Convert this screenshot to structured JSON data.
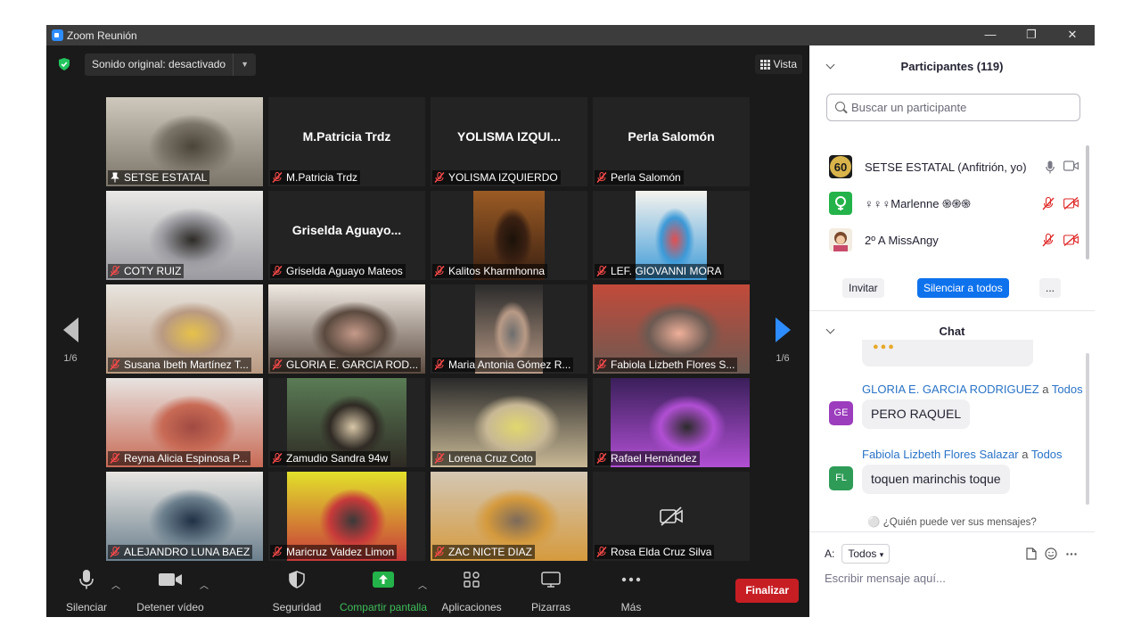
{
  "window": {
    "title": "Zoom Reunión",
    "controls": [
      "—",
      "❐",
      "✕"
    ]
  },
  "meeting": {
    "sound_label": "Sonido original: desactivado",
    "view_label": "Vista",
    "page_left": "1/6",
    "page_right": "1/6",
    "tiles": [
      {
        "center": "",
        "label": "SETSE ESTATAL",
        "video": true
      },
      {
        "center": "M.Patricia Trdz",
        "label": "M.Patricia Trdz",
        "video": false
      },
      {
        "center": "YOLISMA  IZQUI...",
        "label": "YOLISMA IZQUIERDO",
        "video": false
      },
      {
        "center": "Perla Salomón",
        "label": "Perla Salomón",
        "video": false
      },
      {
        "center": "",
        "label": "COTY RUIZ",
        "video": true
      },
      {
        "center": "Griselda  Aguayo...",
        "label": "Griselda Aguayo Mateos",
        "video": false
      },
      {
        "center": "",
        "label": "Kalitos Kharmhonna",
        "video": true
      },
      {
        "center": "",
        "label": "LEF. GIOVANNI MORA",
        "video": true
      },
      {
        "center": "",
        "label": "Susana Ibeth Martínez T...",
        "video": true
      },
      {
        "center": "",
        "label": "GLORIA E. GARCIA ROD...",
        "video": true
      },
      {
        "center": "",
        "label": "Maria Antonia Gómez R...",
        "video": true
      },
      {
        "center": "",
        "label": "Fabiola Lizbeth Flores S...",
        "video": true
      },
      {
        "center": "",
        "label": "Reyna Alicia Espinosa P...",
        "video": true
      },
      {
        "center": "",
        "label": "Zamudio Sandra 94w",
        "video": true
      },
      {
        "center": "",
        "label": "Lorena Cruz Coto",
        "video": true
      },
      {
        "center": "",
        "label": "Rafael Hernández",
        "video": true
      },
      {
        "center": "",
        "label": "ALEJANDRO LUNA BAEZ",
        "video": true
      },
      {
        "center": "",
        "label": "Maricruz Valdez Limon",
        "video": true
      },
      {
        "center": "",
        "label": "ZAC NICTE DIAZ",
        "video": true
      },
      {
        "center": "",
        "label": "Rosa Elda Cruz Silva",
        "video": false
      }
    ]
  },
  "toolbar": {
    "mute": "Silenciar",
    "video": "Detener vídeo",
    "security": "Seguridad",
    "share": "Compartir pantalla",
    "apps": "Aplicaciones",
    "whiteboards": "Pizarras",
    "more": "Más",
    "end": "Finalizar"
  },
  "participants": {
    "header": "Participantes (119)",
    "search_placeholder": "Buscar un participante",
    "list": [
      {
        "name": "SETSE ESTATAL (Anfitrión, yo)"
      },
      {
        "name": "♀♀♀Marlenne ֍֍֍"
      },
      {
        "name": "2º A  MissAngy"
      }
    ],
    "invite": "Invitar",
    "mute_all": "Silenciar a todos",
    "more": "..."
  },
  "chat": {
    "header": "Chat",
    "messages": [
      {
        "from": "GLORIA E. GARCIA RODRIGUEZ",
        "to_word": "a",
        "to": "Todos",
        "initials": "GE",
        "text": "PERO RAQUEL",
        "avatar_color": "#9b3dbd"
      },
      {
        "from": "Fabiola Lizbeth Flores Salazar",
        "to_word": "a",
        "to": "Todos",
        "initials": "FL",
        "text": "toquen marinchis toque",
        "avatar_color": "#2e9c57"
      }
    ],
    "who_can_see": "¿Quién puede ver sus mensajes?",
    "to_label": "A:",
    "to_value": "Todos",
    "compose_placeholder": "Escribir mensaje aquí..."
  },
  "colors": {
    "accent": "#2d8cff",
    "end": "#c71e24",
    "share": "#3fbd5a",
    "active_speaker": "#d8e63b"
  }
}
